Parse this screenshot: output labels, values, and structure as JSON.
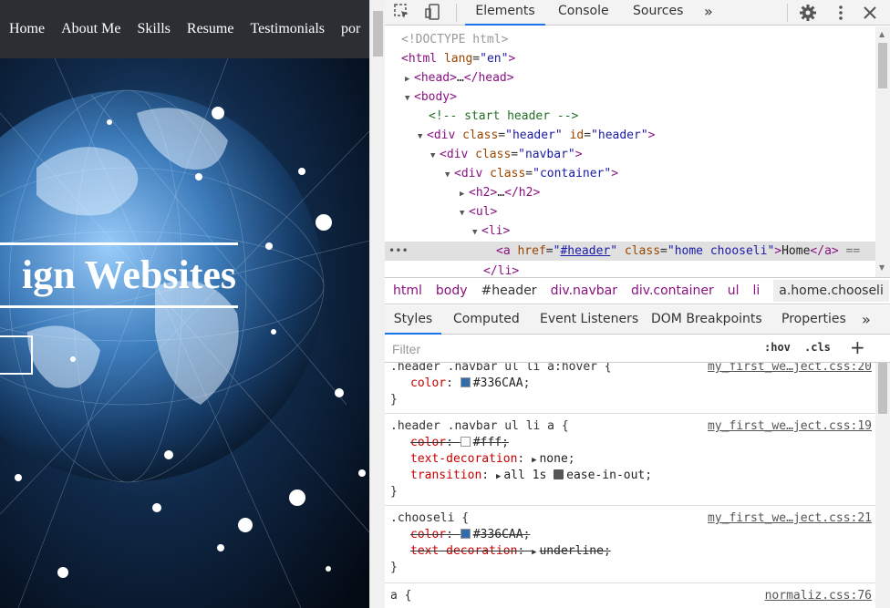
{
  "page": {
    "nav_items": [
      "Home",
      "About Me",
      "Skills",
      "Resume",
      "Testimonials",
      "por"
    ],
    "hero_title": "ign Websites"
  },
  "devtools": {
    "tabs": {
      "elements": "Elements",
      "console": "Console",
      "sources": "Sources",
      "more": "»"
    },
    "icons": [
      "inspect-element-icon",
      "device-toolbar-icon",
      "gear-icon",
      "kebab-menu-icon",
      "close-icon"
    ],
    "dom": {
      "doctype": "<!DOCTYPE html>",
      "html_tag": "html",
      "lang_attr": "lang",
      "lang_val": "en",
      "head_collapsed": "head",
      "body_tag": "body",
      "comment": "<!-- start header -->",
      "div_tag": "div",
      "class_attr": "class",
      "id_attr": "id",
      "header_class": "header",
      "header_id": "header",
      "navbar_class": "navbar",
      "container_class": "container",
      "h2_tag": "h2",
      "ul_tag": "ul",
      "li_tag": "li",
      "a_tag": "a",
      "href_attr": "href",
      "href_val": "#header",
      "a_class": "home chooseli",
      "a_text": "Home",
      "selected_suffix": "==",
      "ellipsis": "…",
      "dots": "•••"
    },
    "breadcrumb": [
      "html",
      "body",
      "#header",
      "div.navbar",
      "div.container",
      "ul",
      "li",
      "a.home.chooseli"
    ],
    "styles_tabs": [
      "Styles",
      "Computed",
      "Event Listeners",
      "DOM Breakpoints",
      "Properties",
      "»"
    ],
    "filter": {
      "placeholder": "Filter",
      "value": "",
      "hov": ":hov",
      "cls": ".cls",
      "add": "+"
    },
    "rules": [
      {
        "selector": ".header .navbar ul li a:hover {",
        "source": "my_first_we…ject.css:20",
        "props": [
          {
            "name": "color",
            "value": "#336CAA",
            "swatch": "#336CAA",
            "struck": false
          }
        ]
      },
      {
        "selector": ".header .navbar ul li a {",
        "source": "my_first_we…ject.css:19",
        "props": [
          {
            "name": "color",
            "value": "#fff",
            "swatch": "#ffffff",
            "struck": true
          },
          {
            "name": "text-decoration",
            "value": "none",
            "struck": false,
            "arrow": true
          },
          {
            "name": "transition",
            "value": "all 1s",
            "value2": "ease-in-out",
            "struck": false,
            "arrow": true
          }
        ]
      },
      {
        "selector": ".chooseli {",
        "source": "my_first_we…ject.css:21",
        "props": [
          {
            "name": "color",
            "value": "#336CAA",
            "swatch": "#336CAA",
            "struck": true
          },
          {
            "name": "text-decoration",
            "value": "underline",
            "struck": true,
            "arrow": true
          }
        ]
      },
      {
        "selector": "a {",
        "source": "normaliz.css:76",
        "props": []
      }
    ],
    "close_brace": "}"
  }
}
